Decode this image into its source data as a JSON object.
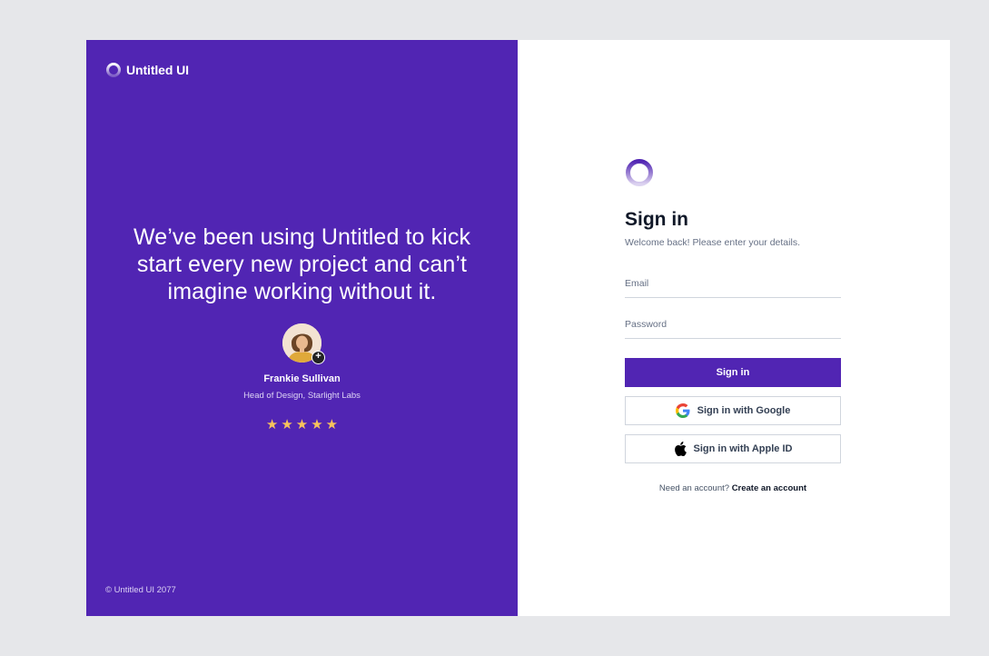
{
  "brand": {
    "name": "Untitled UI"
  },
  "testimonial": {
    "quote": "We’ve been using Untitled to kick start every new project and can’t imagine working without it.",
    "author_name": "Frankie Sullivan",
    "author_role": "Head of Design, Starlight Labs",
    "rating": 5,
    "stars": [
      "★",
      "★",
      "★",
      "★",
      "★"
    ]
  },
  "copyright": "© Untitled UI 2077",
  "signin": {
    "title": "Sign in",
    "subtitle": "Welcome back! Please enter your details.",
    "email_placeholder": "Email",
    "password_placeholder": "Password",
    "submit_label": "Sign in",
    "google_label": "Sign in with Google",
    "apple_label": "Sign in with Apple ID",
    "footer_text": "Need an account?",
    "footer_link": "Create an account"
  },
  "colors": {
    "brand": "#5125b3",
    "star": "#f7c25d",
    "page_bg": "#e6e7ea"
  },
  "icons": {
    "brand_logo": "ring-logo-icon",
    "google": "google-icon",
    "apple": "apple-icon",
    "avatar_badge": "plus-icon",
    "star": "star-icon"
  }
}
